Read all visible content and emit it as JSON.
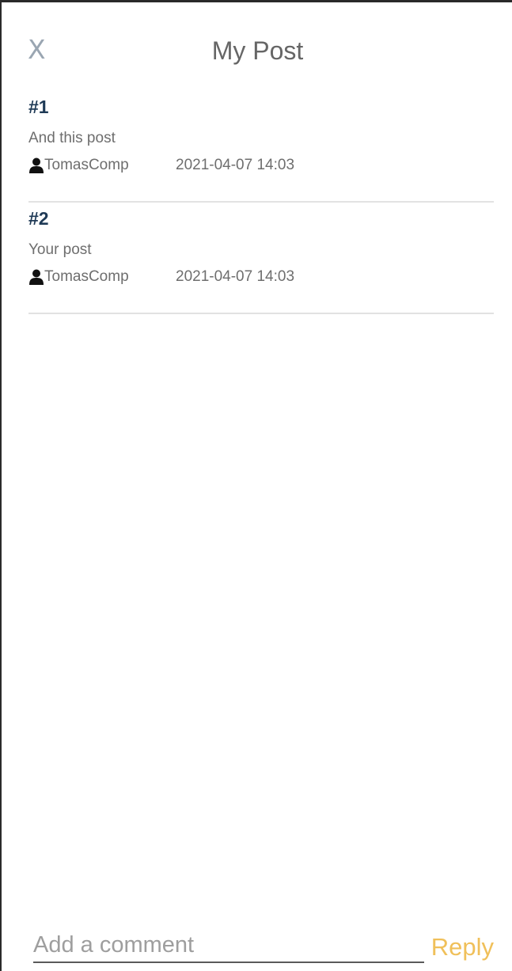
{
  "header": {
    "close_label": "X",
    "title": "My Post"
  },
  "posts": [
    {
      "number": "#1",
      "body": "And this post",
      "author": "TomasComp",
      "date": "2021-04-07 14:03",
      "author_icon": "user-icon"
    },
    {
      "number": "#2",
      "body": "Your post",
      "author": "TomasComp",
      "date": "2021-04-07 14:03",
      "author_icon": "user-icon"
    }
  ],
  "comment": {
    "placeholder": "Add a comment",
    "value": "",
    "reply_label": "Reply"
  },
  "colors": {
    "post_number": "#1f3a56",
    "reply": "#f0c05a",
    "close": "#9aa6b2"
  }
}
